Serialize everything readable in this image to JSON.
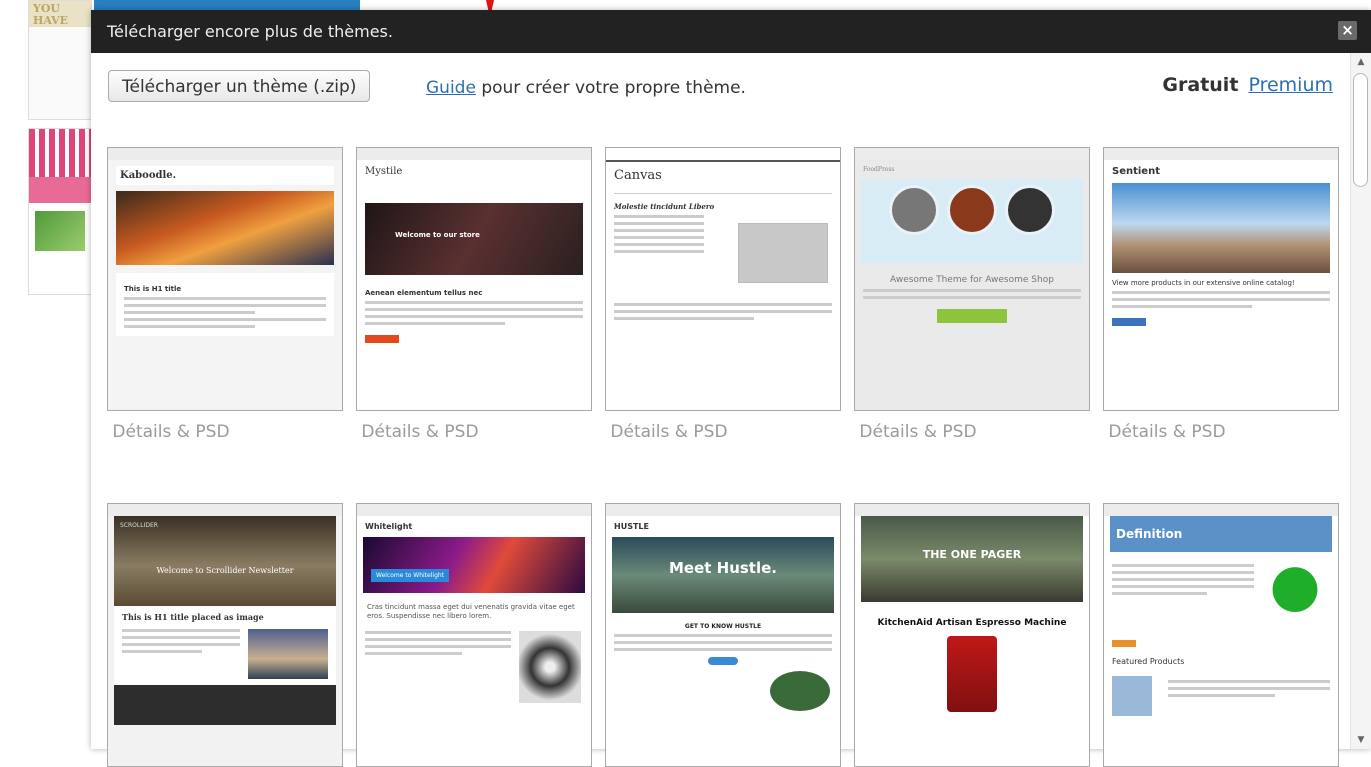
{
  "background_page": {
    "thumb_text": "YOU HAVE GOT M"
  },
  "modal": {
    "title": "Télécharger encore plus de thèmes.",
    "close_label": "×",
    "upload_button": "Télécharger un thème (.zip)",
    "guide_link": "Guide",
    "guide_suffix": " pour créer votre propre thème.",
    "pricing_free": "Gratuit",
    "pricing_premium": "Premium"
  },
  "themes": [
    {
      "name": "Kaboodle.",
      "details": "Détails & PSD",
      "hero_text": "",
      "subtitle": "This is H1 title"
    },
    {
      "name": "Mystile",
      "details": "Détails & PSD",
      "hero_text": "Welcome to our store",
      "subtitle": "Aenean elementum tellus nec"
    },
    {
      "name": "Canvas",
      "details": "Détails & PSD",
      "hero_text": "",
      "subtitle": "Molestie tincidunt Libero"
    },
    {
      "name": "FoodPress",
      "details": "Détails & PSD",
      "hero_text": "",
      "subtitle": "Awesome Theme for Awesome Shop"
    },
    {
      "name": "Sentient",
      "details": "Détails & PSD",
      "hero_text": "",
      "subtitle": "View more products in our extensive online catalog!"
    },
    {
      "name": "SCROLLIDER",
      "details": "",
      "hero_text": "Welcome to Scrollider Newsletter",
      "subtitle": "This is H1 title placed as image"
    },
    {
      "name": "Whitelight",
      "details": "",
      "hero_text": "Welcome to Whitelight",
      "subtitle": "Cras tincidunt massa eget dui venenatis gravida vitae eget eros. Suspendisse nec libero lorem."
    },
    {
      "name": "HUSTLE",
      "details": "",
      "hero_text": "Meet Hustle.",
      "subtitle": "GET TO KNOW HUSTLE"
    },
    {
      "name": "THE ONE PAGER",
      "details": "",
      "hero_text": "THE ONE PAGER",
      "subtitle": "KitchenAid Artisan Espresso Machine"
    },
    {
      "name": "Definition",
      "details": "",
      "hero_text": "",
      "subtitle": "Featured Products"
    }
  ],
  "colors": {
    "titlebar": "#222222",
    "link": "#2a6fb5",
    "details_text": "#9a9a9a"
  }
}
